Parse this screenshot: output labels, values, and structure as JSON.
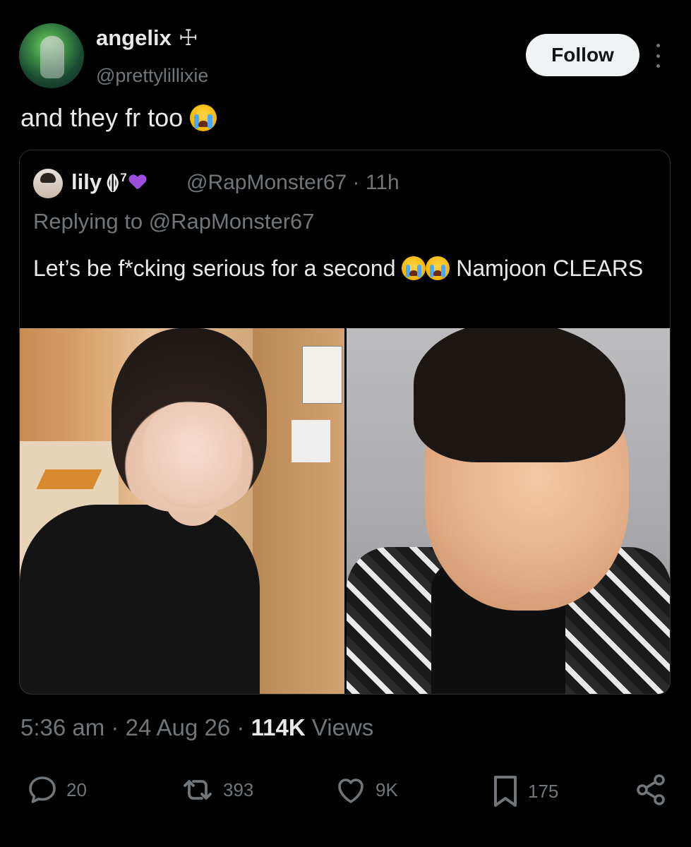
{
  "header": {
    "display_name": "angelix",
    "name_symbol": "☩",
    "handle": "@prettylillixie",
    "follow_label": "Follow"
  },
  "tweet": {
    "text": "and they fr too",
    "emoji": "loudly-crying-face"
  },
  "quote": {
    "display_name": "lily",
    "name_badge": "⟬⟭",
    "name_sup": "7",
    "handle_time": "@RapMonster67 · 11h",
    "replying_to": "Replying to @RapMonster67",
    "text_before": "Let’s be f*cking serious for a second",
    "text_after": "Namjoon CLEARS",
    "images": [
      "left-selfie-photo",
      "right-portrait-photo"
    ]
  },
  "meta": {
    "time": "5:36 am",
    "sep1": "·",
    "date": "24 Aug 26",
    "sep2": "·",
    "views_count": "114K",
    "views_label": "Views"
  },
  "actions": {
    "reply_count": "20",
    "repost_count": "393",
    "like_count": "9K",
    "bookmark_count": "175"
  },
  "colors": {
    "background": "#000000",
    "text": "#e7e9ea",
    "muted": "#71767b",
    "border": "#2f3336",
    "heart_badge": "#9b4ddc"
  }
}
